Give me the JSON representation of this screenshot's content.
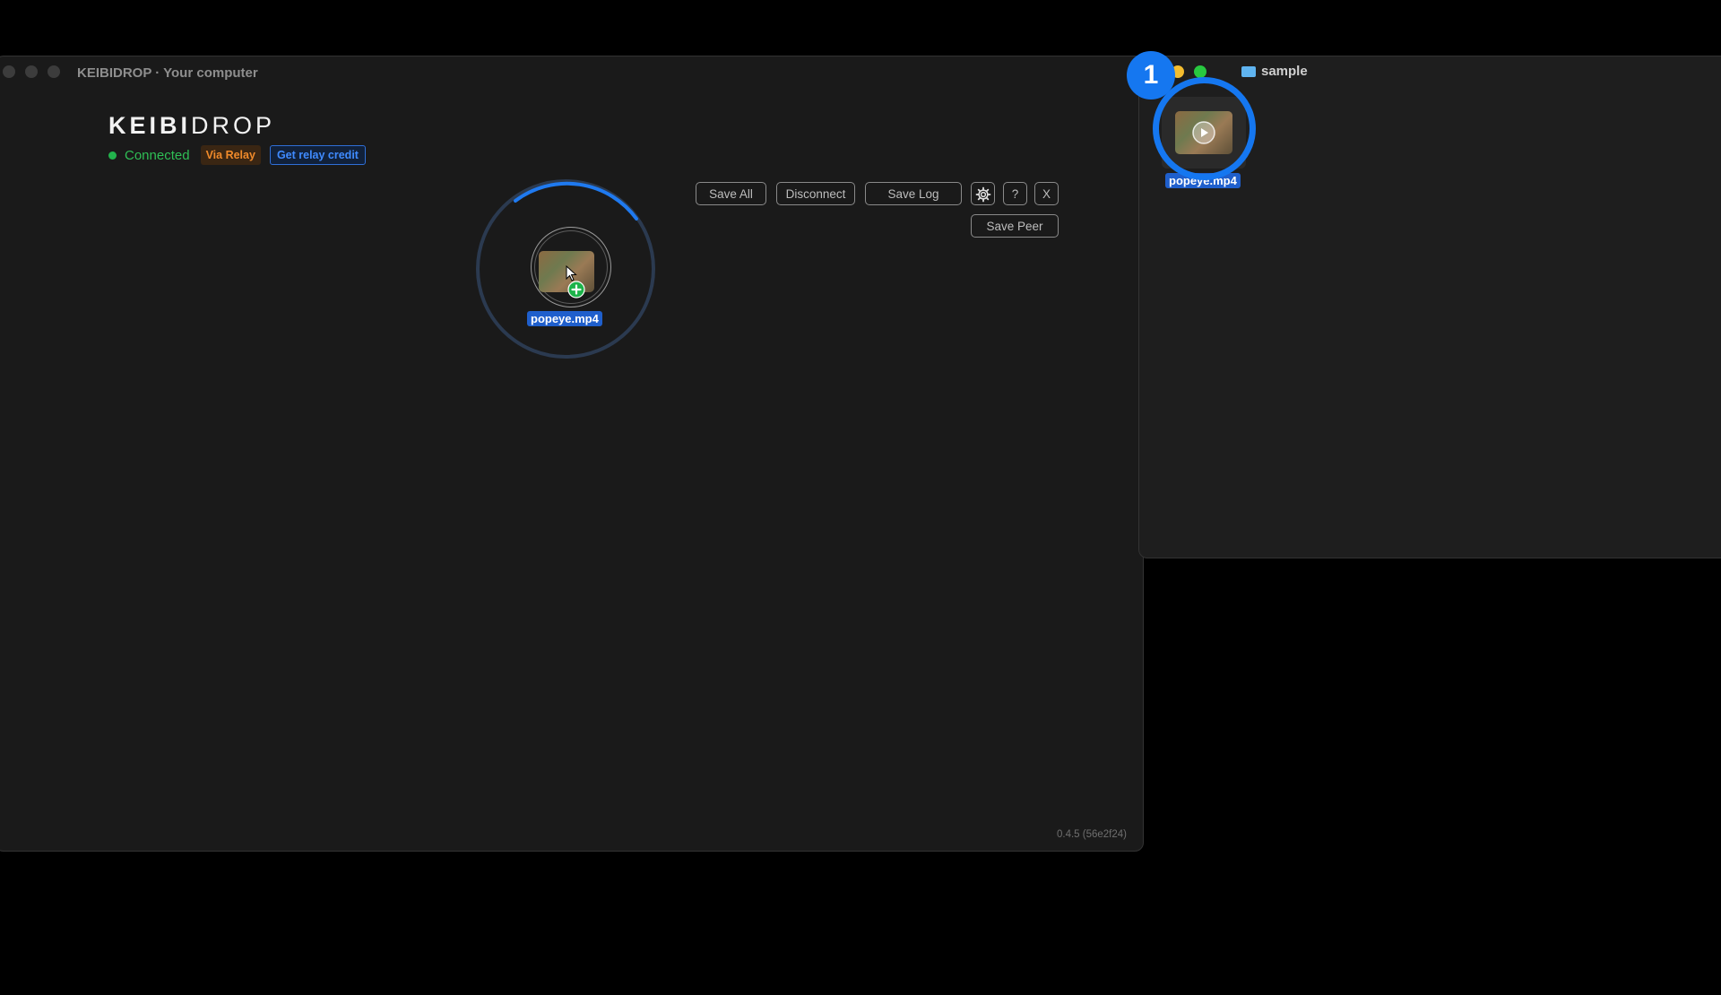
{
  "main_window": {
    "title": "KEIBIDROP · Your computer",
    "logo_bold": "KEIBI",
    "logo_light": "DROP",
    "status": "Connected",
    "relay_badge": "Via Relay",
    "relay_credit": "Get relay credit",
    "buttons": {
      "save_all": "Save All",
      "disconnect": "Disconnect",
      "save_log": "Save Log",
      "help": "?",
      "close": "X",
      "save_peer": "Save Peer"
    },
    "drop_file": "popeye.mp4",
    "version": "0.4.5 (56e2f24)"
  },
  "finder_window": {
    "title": "sample",
    "file_name": "popeye.mp4"
  },
  "overlay": {
    "step_number": "1"
  },
  "colors": {
    "accent_blue": "#1577f0",
    "connected_green": "#2fbf55",
    "relay_orange": "#f08a2a"
  },
  "icons": [
    "settings-gear-icon",
    "add-plus-icon",
    "play-icon",
    "folder-icon"
  ]
}
